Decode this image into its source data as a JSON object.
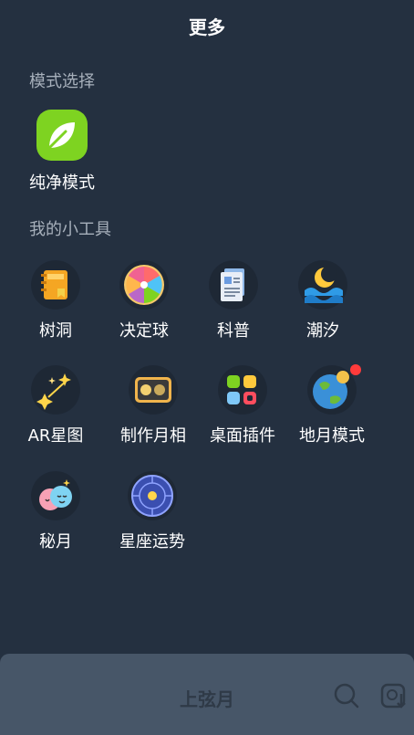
{
  "header": {
    "title": "更多"
  },
  "mode_section": {
    "label": "模式选择",
    "items": [
      {
        "label": "纯净模式",
        "icon": "leaf-icon"
      }
    ]
  },
  "tools_section": {
    "label": "我的小工具",
    "items": [
      {
        "label": "树洞",
        "icon": "notebook-icon"
      },
      {
        "label": "决定球",
        "icon": "spinner-wheel-icon"
      },
      {
        "label": "科普",
        "icon": "document-icon"
      },
      {
        "label": "潮汐",
        "icon": "tide-icon"
      },
      {
        "label": "AR星图",
        "icon": "sparkles-icon"
      },
      {
        "label": "制作月相",
        "icon": "moon-phase-card-icon"
      },
      {
        "label": "桌面插件",
        "icon": "widget-icon"
      },
      {
        "label": "地月模式",
        "icon": "earth-moon-icon",
        "badge": true
      },
      {
        "label": "秘月",
        "icon": "twin-faces-icon"
      },
      {
        "label": "星座运势",
        "icon": "zodiac-wheel-icon"
      }
    ]
  },
  "bottom_bar": {
    "phase_label": "上弦月"
  },
  "colors": {
    "background": "#243040",
    "bottom_bar": "#475668",
    "accent_green": "#7ed321",
    "badge_red": "#ff3b3b"
  }
}
